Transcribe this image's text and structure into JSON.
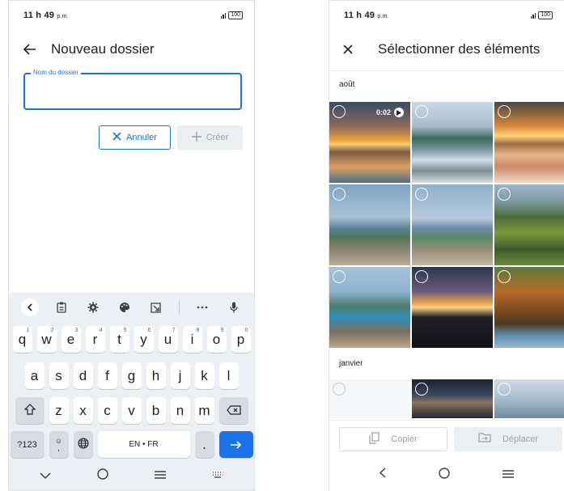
{
  "left": {
    "status": {
      "time": "11 h 49",
      "ampm": "p.m.",
      "battery": "100"
    },
    "appbar": {
      "title": "Nouveau dossier"
    },
    "field": {
      "label": "Nom du dossier",
      "value": ""
    },
    "actions": {
      "cancel_label": "Annuler",
      "create_label": "Créer"
    },
    "keyboard": {
      "toolbar_icons": [
        "chevron-left-icon",
        "clipboard-icon",
        "settings-icon",
        "palette-icon",
        "resize-icon",
        "more-icon",
        "mic-icon"
      ],
      "row1": [
        {
          "k": "q",
          "h": "1"
        },
        {
          "k": "w",
          "h": "2"
        },
        {
          "k": "e",
          "h": "3"
        },
        {
          "k": "r",
          "h": "4"
        },
        {
          "k": "t",
          "h": "5"
        },
        {
          "k": "y",
          "h": "6"
        },
        {
          "k": "u",
          "h": "7"
        },
        {
          "k": "i",
          "h": "8"
        },
        {
          "k": "o",
          "h": "9"
        },
        {
          "k": "p",
          "h": "0"
        }
      ],
      "row2": [
        "a",
        "s",
        "d",
        "f",
        "g",
        "h",
        "j",
        "k",
        "l"
      ],
      "row3": [
        "z",
        "x",
        "c",
        "v",
        "b",
        "n",
        "m"
      ],
      "symbols_label": "?123",
      "comma_label": ",",
      "space_label": "EN • FR",
      "period_label": "."
    },
    "nav": [
      "chevron-down-icon",
      "home-icon",
      "menu-icon",
      "keyboard-icon"
    ]
  },
  "right": {
    "status": {
      "time": "11 h 49",
      "ampm": "p.m.",
      "battery": "100"
    },
    "appbar": {
      "title": "Sélectionner des éléments"
    },
    "sections": [
      {
        "label": "août",
        "photos": [
          {
            "name": "sunset-lake-video",
            "duration": "0:02"
          },
          {
            "name": "misty-lake-waterfall"
          },
          {
            "name": "snowy-sunset-field"
          },
          {
            "name": "lake-rocks-overlook"
          },
          {
            "name": "lake-rocks-overlook-2"
          },
          {
            "name": "green-valley-mountains"
          },
          {
            "name": "blue-lake-cliffs"
          },
          {
            "name": "coastline-sunset"
          },
          {
            "name": "pine-forest-lake"
          }
        ]
      },
      {
        "label": "janvier",
        "photos": [
          {
            "name": "screenshot-thumb"
          },
          {
            "name": "dark-blurred-shot"
          },
          {
            "name": "lake-horizon"
          }
        ]
      }
    ],
    "actions": {
      "copy_label": "Copier",
      "move_label": "Déplacer"
    },
    "nav": [
      "back-icon",
      "home-icon",
      "menu-icon"
    ]
  }
}
